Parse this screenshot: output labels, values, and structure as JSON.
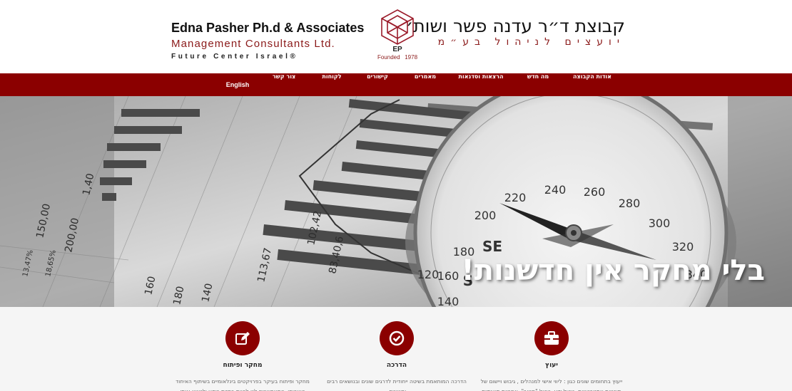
{
  "header": {
    "company_en_line1": "Edna Pasher Ph.d & Associates",
    "company_en_line2": "Management Consultants Ltd.",
    "company_en_line3": "Future Center Israel®",
    "logo_initials": "EP",
    "founded_label": "Founded",
    "founded_year": "1978",
    "company_he_line1": "קבוצת ד״ר עדנה פשר ושות׳",
    "company_he_line2": "יועצים לניהול בע״מ"
  },
  "nav": {
    "items": [
      {
        "label": "אודות הקבוצה"
      },
      {
        "label": "מה חדש"
      },
      {
        "label": "הרצאות וסדנאות"
      },
      {
        "label": "מאמרים"
      },
      {
        "label": "קישורים"
      },
      {
        "label": "לקוחות"
      },
      {
        "label": "צור קשר"
      },
      {
        "label": "English"
      }
    ]
  },
  "hero": {
    "title": "בלי מחקר אין חדשנות!",
    "compass_labels": [
      "180",
      "200",
      "220",
      "240",
      "260",
      "280",
      "300",
      "320",
      "340",
      "SE",
      "S",
      "160",
      "140",
      "120"
    ],
    "chart_numbers": [
      "113,67",
      "83,40,6",
      "102,42",
      "150,00",
      "200,00",
      "140",
      "160",
      "1,40",
      "180",
      "18,65%",
      "13,47%"
    ]
  },
  "services": [
    {
      "title": "יעוץ",
      "icon": "briefcase-icon",
      "desc": "ייעוץ בתחומים שונים כגון : ליווי אישי למנהלים , גיבוש ויישום של תוכניות אסטרטגיות, ניהול ידע, ניהול \"חטוב\", אחריות תאגידית"
    },
    {
      "title": "הדרכה",
      "icon": "check-circle-icon",
      "desc": "הדרכה המותאמת בשיטה ייחודית לדרגים שונים ובנושאים רבים ומגוונים."
    },
    {
      "title": "מחקר ופיתוח",
      "icon": "edit-icon",
      "desc": "מחקר ופיתוח בעיקר בפרויקטים בינלאומיים בשיתוף האיחוד האירופי, המאפשרים לנו להיות בחזית הידע ולייצוא אותו בארגונים"
    }
  ],
  "colors": {
    "brand_red": "#8b0000",
    "nav_bg": "#8b0000",
    "services_bg": "#f5f5f5"
  }
}
